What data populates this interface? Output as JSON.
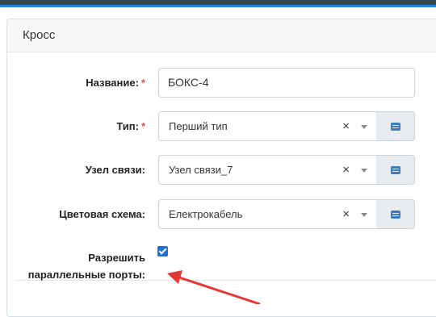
{
  "card": {
    "title": "Кросс"
  },
  "form": {
    "name": {
      "label": "Название:",
      "required_mark": "*",
      "value": "БОКС-4"
    },
    "type": {
      "label": "Тип:",
      "required_mark": "*",
      "value": "Перший тип",
      "clear": "×",
      "icon": "list-icon"
    },
    "node": {
      "label": "Узел связи:",
      "value": "Узел связи_7",
      "clear": "×",
      "icon": "list-icon"
    },
    "color_scheme": {
      "label": "Цветовая схема:",
      "value": "Електрокабель",
      "clear": "×",
      "icon": "list-icon"
    },
    "parallel_ports": {
      "label_line1": "Разрешить",
      "label_line2": "параллельные порты:",
      "checked": true
    }
  },
  "annotation": {
    "arrow_color": "#e53935"
  },
  "colors": {
    "topbar": "#37474f",
    "accent": "#1e88e5",
    "checkbox": "#1976d2",
    "required": "#d9534f"
  }
}
